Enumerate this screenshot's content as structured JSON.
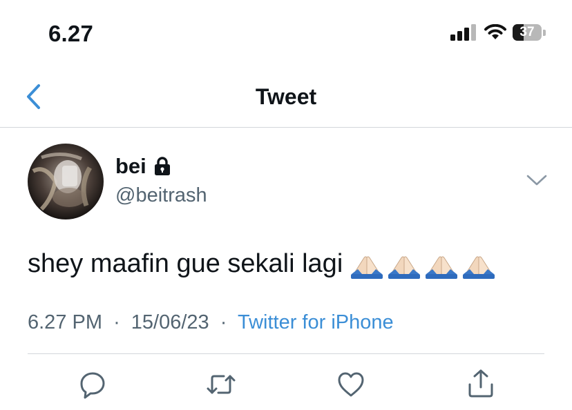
{
  "status_bar": {
    "time": "6.27",
    "battery_level": "37",
    "battery_percent": 37,
    "icons": [
      "signal-icon",
      "wifi-icon",
      "battery-icon"
    ]
  },
  "nav": {
    "title": "Tweet",
    "back_icon": "chevron-left-icon"
  },
  "tweet": {
    "display_name": "bei",
    "protected_icon": "lock-icon",
    "handle": "@beitrash",
    "text": "shey maafin gue sekali lagi",
    "emoji": [
      "🙏🏻",
      "🙏🏻",
      "🙏🏻",
      "🙏🏻"
    ],
    "time": "6.27 PM",
    "date": "15/06/23",
    "separator": "·",
    "source": "Twitter for iPhone"
  },
  "actions": [
    "reply-icon",
    "retweet-icon",
    "like-icon",
    "share-icon"
  ],
  "colors": {
    "link_blue": "#3b8ed6",
    "secondary_text": "#536471",
    "icon_gray": "#536471",
    "divider": "#d3d6da"
  }
}
